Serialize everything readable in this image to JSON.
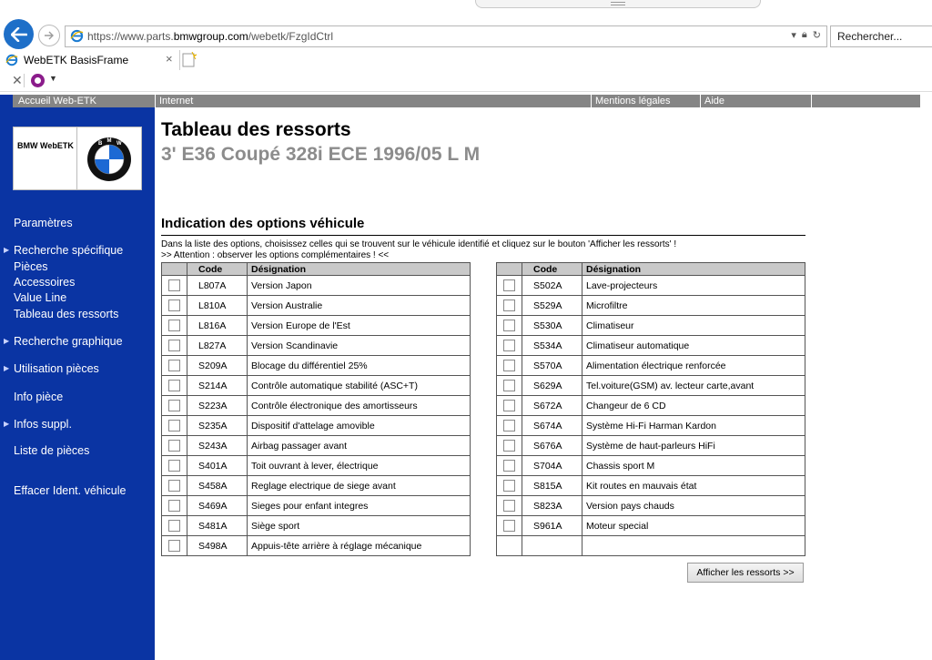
{
  "browser": {
    "url_prefix": "https://www.parts.",
    "url_domain": "bmwgroup.com",
    "url_suffix": "/webetk/FzgIdCtrl",
    "search_placeholder": "Rechercher...",
    "tab_title": "WebETK BasisFrame"
  },
  "sidebar": {
    "header": "Accueil Web-ETK",
    "logo_text": "BMW WebETK",
    "items": [
      {
        "label": "Paramètres",
        "arrow": false
      },
      {
        "label": "Recherche spécifique",
        "arrow": true
      },
      {
        "label": "Pièces",
        "arrow": false
      },
      {
        "label": "Accessoires",
        "arrow": false
      },
      {
        "label": "Value Line",
        "arrow": false
      },
      {
        "label": "Tableau des ressorts",
        "arrow": false
      },
      {
        "label": "Recherche graphique",
        "arrow": true
      },
      {
        "label": "Utilisation pièces",
        "arrow": true
      },
      {
        "label": "Info pièce",
        "arrow": false
      },
      {
        "label": "Infos suppl.",
        "arrow": true
      },
      {
        "label": "Liste de pièces",
        "arrow": false
      },
      {
        "label": "Effacer Ident. véhicule",
        "arrow": false
      }
    ]
  },
  "topnav": {
    "internet": "Internet",
    "mentions": "Mentions légales",
    "aide": "Aide"
  },
  "main": {
    "title": "Tableau des ressorts",
    "subtitle": "3' E36 Coupé 328i ECE 1996/05 L M",
    "section_title": "Indication des options véhicule",
    "instruction1": "Dans la liste des options, choisissez celles qui se trouvent sur le véhicule identifié et cliquez sur le bouton 'Afficher les ressorts' !",
    "instruction2": ">> Attention : observer les options complémentaires ! <<",
    "col_code": "Code",
    "col_designation": "Désignation",
    "button_label": "Afficher les ressorts >>"
  },
  "options_left": [
    {
      "code": "L807A",
      "designation": "Version Japon"
    },
    {
      "code": "L810A",
      "designation": "Version Australie"
    },
    {
      "code": "L816A",
      "designation": "Version Europe de l'Est"
    },
    {
      "code": "L827A",
      "designation": "Version Scandinavie"
    },
    {
      "code": "S209A",
      "designation": "Blocage du différentiel 25%"
    },
    {
      "code": "S214A",
      "designation": "Contrôle automatique stabilité (ASC+T)"
    },
    {
      "code": "S223A",
      "designation": "Contrôle électronique des amortisseurs"
    },
    {
      "code": "S235A",
      "designation": "Dispositif d'attelage amovible"
    },
    {
      "code": "S243A",
      "designation": "Airbag passager avant"
    },
    {
      "code": "S401A",
      "designation": "Toit ouvrant à lever, électrique"
    },
    {
      "code": "S458A",
      "designation": "Reglage electrique de siege avant"
    },
    {
      "code": "S469A",
      "designation": "Sieges pour enfant integres"
    },
    {
      "code": "S481A",
      "designation": "Siège sport"
    },
    {
      "code": "S498A",
      "designation": "Appuis-tête arrière à réglage mécanique"
    }
  ],
  "options_right": [
    {
      "code": "S502A",
      "designation": "Lave-projecteurs"
    },
    {
      "code": "S529A",
      "designation": "Microfiltre"
    },
    {
      "code": "S530A",
      "designation": "Climatiseur"
    },
    {
      "code": "S534A",
      "designation": "Climatiseur automatique"
    },
    {
      "code": "S570A",
      "designation": "Alimentation électrique renforcée"
    },
    {
      "code": "S629A",
      "designation": "Tel.voiture(GSM) av. lecteur carte,avant"
    },
    {
      "code": "S672A",
      "designation": "Changeur de 6 CD"
    },
    {
      "code": "S674A",
      "designation": "Système Hi-Fi Harman Kardon"
    },
    {
      "code": "S676A",
      "designation": "Système de haut-parleurs HiFi"
    },
    {
      "code": "S704A",
      "designation": "Chassis sport M"
    },
    {
      "code": "S815A",
      "designation": "Kit routes en mauvais état"
    },
    {
      "code": "S823A",
      "designation": "Version pays chauds"
    },
    {
      "code": "S961A",
      "designation": "Moteur special"
    }
  ]
}
